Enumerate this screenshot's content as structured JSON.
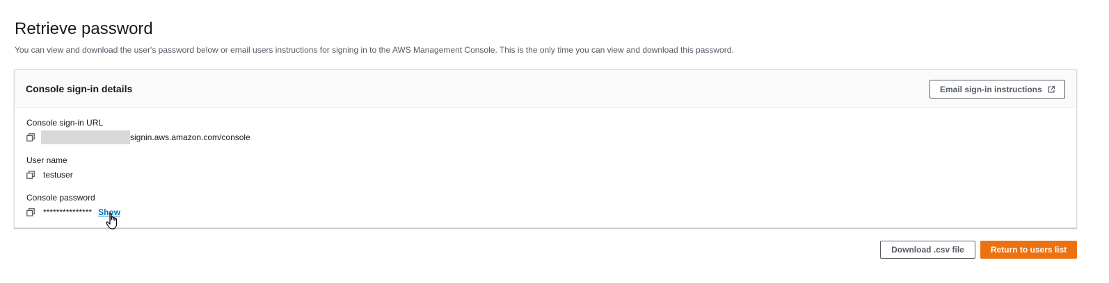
{
  "header": {
    "title": "Retrieve password",
    "description": "You can view and download the user's password below or email users instructions for signing in to the AWS Management Console. This is the only time you can view and download this password."
  },
  "panel": {
    "title": "Console sign-in details",
    "email_button_label": "Email sign-in instructions",
    "email_button_icon": "external-link-icon",
    "fields": {
      "url": {
        "label": "Console sign-in URL",
        "value": "signin.aws.amazon.com/console",
        "icon": "copy-icon"
      },
      "username": {
        "label": "User name",
        "value": "testuser",
        "icon": "copy-icon"
      },
      "password": {
        "label": "Console password",
        "value": "***************",
        "show_label": "Show",
        "icon": "copy-icon"
      }
    }
  },
  "footer": {
    "download_label": "Download .csv file",
    "return_label": "Return to users list"
  },
  "colors": {
    "primary": "#ec7211",
    "link": "#0073bb",
    "text": "#16191f",
    "border": "#545b64"
  }
}
